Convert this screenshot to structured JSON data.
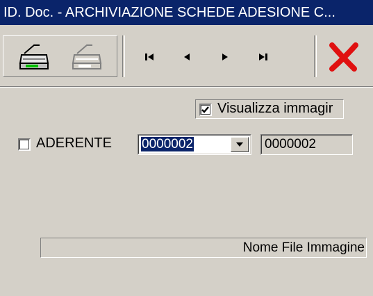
{
  "window": {
    "title": "ID. Doc. - ARCHIVIAZIONE SCHEDE ADESIONE C..."
  },
  "toolbar": {
    "buttons": [
      {
        "icon": "scanner-icon"
      },
      {
        "icon": "scanner-disabled-icon"
      },
      {
        "icon": "first-record-icon"
      },
      {
        "icon": "previous-record-icon"
      },
      {
        "icon": "next-record-icon"
      },
      {
        "icon": "last-record-icon"
      },
      {
        "icon": "close-x-icon"
      }
    ]
  },
  "form": {
    "show_image": {
      "label": "Visualizza immagir",
      "checked": true
    },
    "aderente": {
      "label": "ADERENTE",
      "checked": false,
      "combo_value": "0000002",
      "display_value": "0000002"
    },
    "image_file": {
      "label": "Nome File Immagine"
    }
  },
  "colors": {
    "titlebar": "#0a246a",
    "face": "#d4d0c8",
    "selection": "#0a246a",
    "close_red": "#e01010"
  }
}
